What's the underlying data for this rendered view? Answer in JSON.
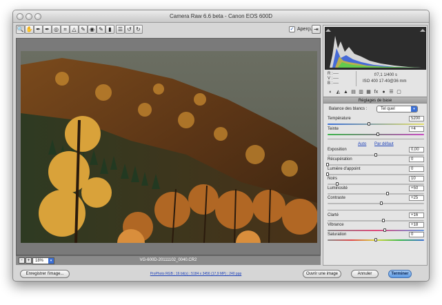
{
  "window": {
    "title": "Camera Raw 6.6 beta  -  Canon EOS 600D"
  },
  "toolbar": {
    "tools": [
      {
        "name": "zoom-tool",
        "glyph": "🔍"
      },
      {
        "name": "hand-tool",
        "glyph": "✋"
      },
      {
        "name": "white-balance-tool",
        "glyph": "✒"
      },
      {
        "name": "color-sampler-tool",
        "glyph": "✒"
      },
      {
        "name": "targeted-adjustment-tool",
        "glyph": "◎"
      },
      {
        "name": "crop-tool",
        "glyph": "⌗"
      },
      {
        "name": "straighten-tool",
        "glyph": "△"
      },
      {
        "name": "spot-removal-tool",
        "glyph": "✎"
      },
      {
        "name": "red-eye-tool",
        "glyph": "◉"
      },
      {
        "name": "adjustment-brush-tool",
        "glyph": "✎"
      },
      {
        "name": "graduated-filter-tool",
        "glyph": "▮"
      },
      {
        "name": "preferences-tool",
        "glyph": "☰"
      },
      {
        "name": "rotate-left-tool",
        "glyph": "↺"
      },
      {
        "name": "rotate-right-tool",
        "glyph": "↻"
      }
    ],
    "preview_label": "Aperçu",
    "preview_checked": "✓",
    "fullscreen_glyph": "⇥"
  },
  "zoom": {
    "minus": "-",
    "plus": "+",
    "level": "18%",
    "arrow": "▾"
  },
  "filename": "VG-600D-20111102_0040.CR2",
  "readout": {
    "r_label": "R :",
    "v_label": "V :",
    "b_label": "B :",
    "rgb_value": "----",
    "aperture_shutter": "f/7,1   1/400 s",
    "iso_lens": "ISO 400   17-40@36 mm"
  },
  "panel_tabs": [
    "◐",
    "◭",
    "▲",
    "▤",
    "▥",
    "▦",
    "fx",
    "●",
    "☰",
    "▢"
  ],
  "section_title": "Réglages de base",
  "white_balance": {
    "label": "Balance des blancs :",
    "value": "Tel quel",
    "arrow": "▾"
  },
  "links": {
    "auto": "Auto",
    "default": "Par défaut"
  },
  "sliders": [
    {
      "id": "temperature",
      "label": "Température",
      "value": "5200",
      "pos": 0.43,
      "track": "linear-gradient(90deg,#3a6fd8,#e8e26a)"
    },
    {
      "id": "tint",
      "label": "Teinte",
      "value": "+4",
      "pos": 0.52,
      "track": "linear-gradient(90deg,#3bb54a,#c94bc2)"
    },
    {
      "id": "exposure",
      "label": "Exposition",
      "value": "0,00",
      "pos": 0.5,
      "track": "#b9b9b9"
    },
    {
      "id": "recovery",
      "label": "Récupération",
      "value": "0",
      "pos": 0.0,
      "track": "#b9b9b9"
    },
    {
      "id": "fill-light",
      "label": "Lumière d'appoint",
      "value": "0",
      "pos": 0.0,
      "track": "#b9b9b9"
    },
    {
      "id": "blacks",
      "label": "Noirs",
      "value": "10",
      "pos": 0.1,
      "track": "#b9b9b9"
    },
    {
      "id": "brightness",
      "label": "Luminosité",
      "value": "+50",
      "pos": 0.62,
      "track": "#b9b9b9"
    },
    {
      "id": "contrast",
      "label": "Contraste",
      "value": "+25",
      "pos": 0.56,
      "track": "#b9b9b9"
    },
    {
      "id": "clarity",
      "label": "Clarté",
      "value": "+16",
      "pos": 0.58,
      "track": "#b9b9b9"
    },
    {
      "id": "vibrance",
      "label": "Vibrance",
      "value": "+18",
      "pos": 0.59,
      "track": "linear-gradient(90deg,#8a8a8a,#e04a7a,#6a9be0)"
    },
    {
      "id": "saturation",
      "label": "Saturation",
      "value": "0",
      "pos": 0.5,
      "track": "linear-gradient(90deg,#8a8a8a,#e04a4a,#d8d83a,#3ab84a,#3a6fd8)"
    }
  ],
  "bottom": {
    "save_label": "Enregistrer l'image...",
    "info_link": "ProPhoto RGB ; 16 bit(s) ; 5184 x 3456 (17,9 MP) ; 240 ppp",
    "open_label": "Ouvrir une image",
    "cancel_label": "Annuler",
    "done_label": "Terminer"
  }
}
